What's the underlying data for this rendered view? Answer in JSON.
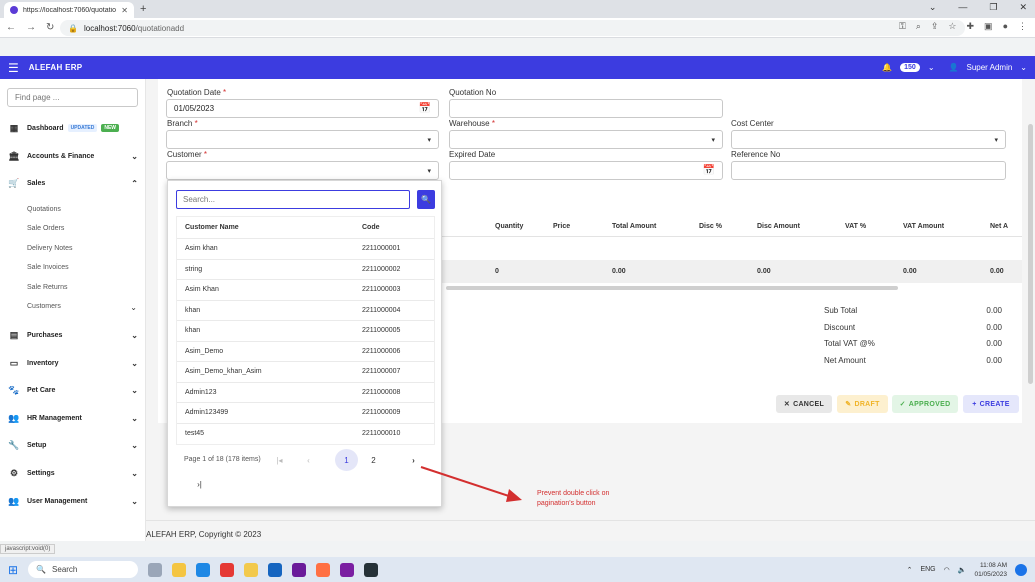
{
  "browser": {
    "tab_title": "https://localhost:7060/quotation",
    "url_host": "localhost:7060",
    "url_path": "/quotationadd"
  },
  "app": {
    "brand": "ALEFAH ERP",
    "notification_count": "150",
    "user_name": "Super Admin"
  },
  "sidebar": {
    "find_placeholder": "Find page ...",
    "items": [
      {
        "label": "Dashboard",
        "tag_updated": "UPDATED",
        "tag_new": "NEW"
      },
      {
        "label": "Accounts & Finance"
      },
      {
        "label": "Sales"
      },
      {
        "label": "Purchases"
      },
      {
        "label": "Inventory"
      },
      {
        "label": "Pet Care"
      },
      {
        "label": "HR Management"
      },
      {
        "label": "Setup"
      },
      {
        "label": "Settings"
      },
      {
        "label": "User Management"
      }
    ],
    "sales_sub": [
      "Quotations",
      "Sale Orders",
      "Delivery Notes",
      "Sale Invoices",
      "Sale Returns",
      "Customers"
    ]
  },
  "form": {
    "quotation_date_label": "Quotation Date",
    "quotation_date_value": "01/05/2023",
    "quotation_no_label": "Quotation No",
    "branch_label": "Branch",
    "warehouse_label": "Warehouse",
    "cost_center_label": "Cost Center",
    "customer_label": "Customer",
    "expired_date_label": "Expired Date",
    "reference_no_label": "Reference No",
    "required_mark": "*"
  },
  "grid": {
    "headers": [
      "Quantity",
      "Price",
      "Total Amount",
      "Disc %",
      "Disc Amount",
      "VAT %",
      "VAT Amount",
      "Net A"
    ],
    "row": [
      "0",
      "0.00",
      "0.00",
      "0.00",
      "0.00"
    ]
  },
  "totals": [
    {
      "label": "Sub Total",
      "value": "0.00"
    },
    {
      "label": "Discount",
      "value": "0.00"
    },
    {
      "label": "Total VAT @%",
      "value": "0.00"
    },
    {
      "label": "Net Amount",
      "value": "0.00"
    }
  ],
  "buttons": {
    "cancel": "CANCEL",
    "draft": "DRAFT",
    "approved": "APPROVED",
    "create": "CREATE"
  },
  "customer_popup": {
    "search_placeholder": "Search...",
    "col_name": "Customer Name",
    "col_code": "Code",
    "rows": [
      {
        "name": "Asim khan",
        "code": "2211000001"
      },
      {
        "name": "string",
        "code": "2211000002"
      },
      {
        "name": "Asim Khan",
        "code": "2211000003"
      },
      {
        "name": "khan",
        "code": "2211000004"
      },
      {
        "name": "khan",
        "code": "2211000005"
      },
      {
        "name": "Asim_Demo",
        "code": "2211000006"
      },
      {
        "name": "Asim_Demo_khan_Asim",
        "code": "2211000007"
      },
      {
        "name": "Admin123",
        "code": "2211000008"
      },
      {
        "name": "Admin123499",
        "code": "2211000009"
      },
      {
        "name": "test45",
        "code": "2211000010"
      }
    ],
    "pager_info": "Page 1 of 18 (178 items)",
    "page_1": "1",
    "page_2": "2"
  },
  "annotation": "Prevent double click on pagination's button",
  "footer": "ALEFAH ERP, Copyright © 2023",
  "status_link": "javascript:void(0)",
  "taskbar": {
    "search": "Search",
    "lang": "ENG",
    "time": "11:08 AM",
    "date": "01/05/2023"
  }
}
